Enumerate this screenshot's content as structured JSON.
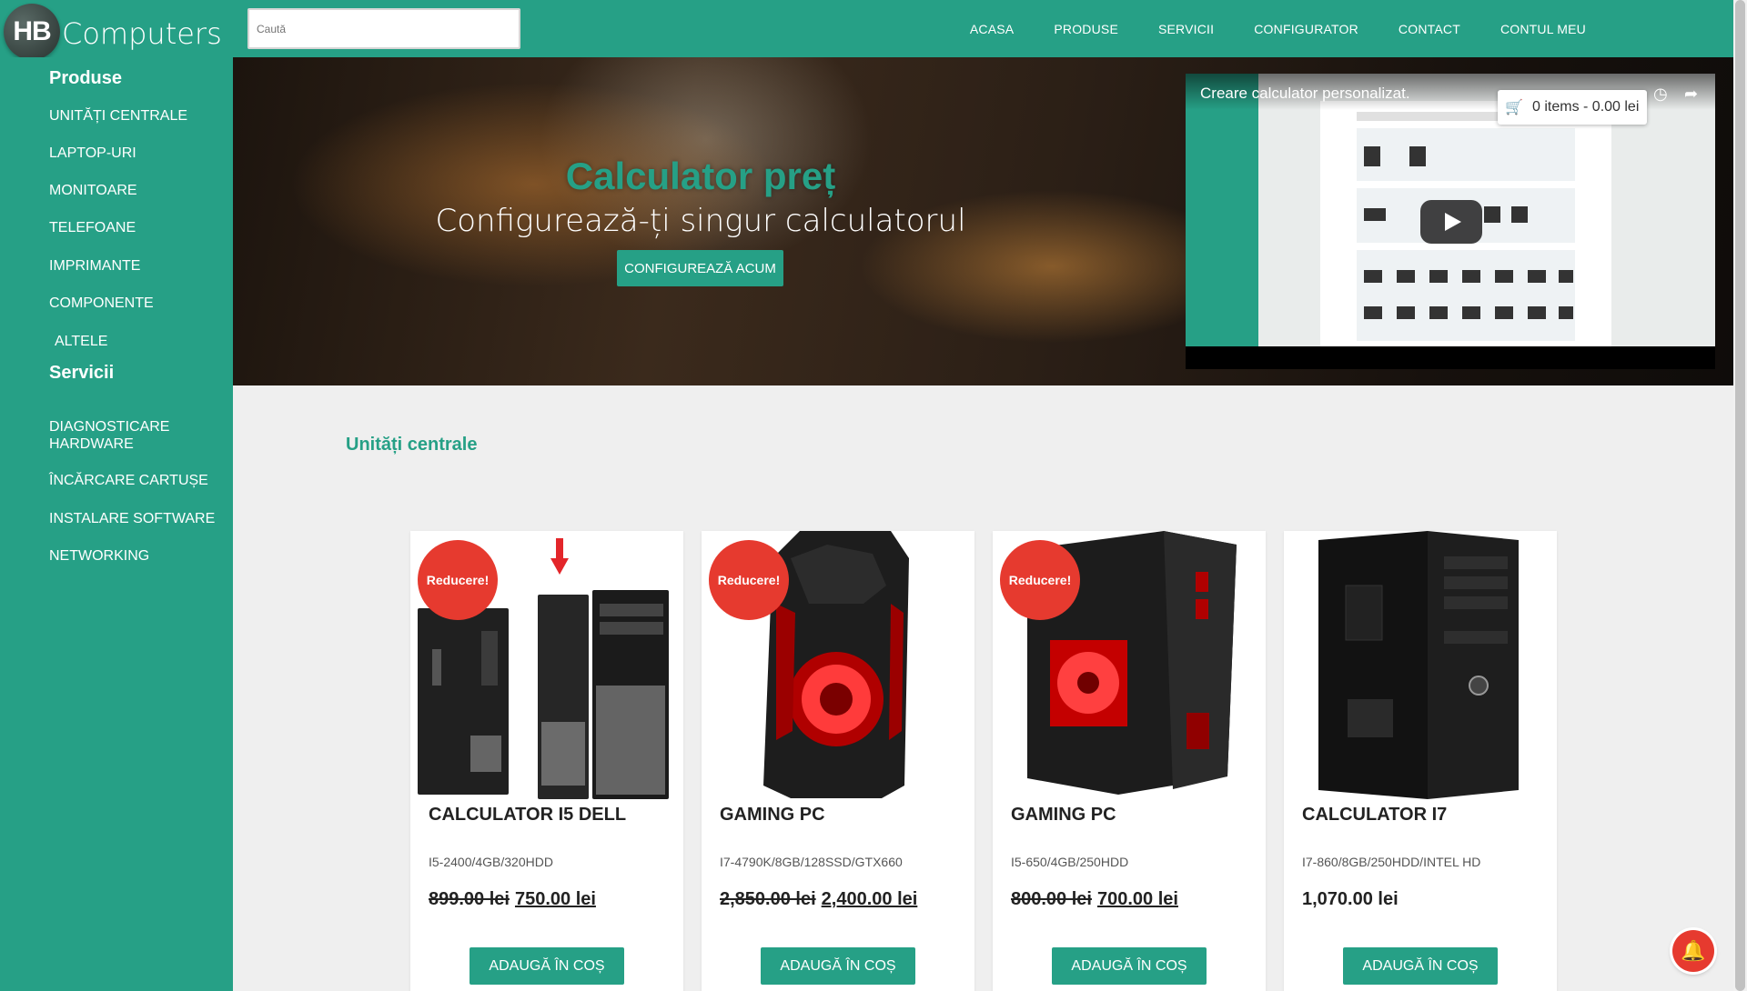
{
  "brand": {
    "logo_initials": "HB",
    "name": "Computers"
  },
  "search": {
    "placeholder": "Caută"
  },
  "nav": [
    "ACASA",
    "PRODUSE",
    "SERVICII",
    "CONFIGURATOR",
    "CONTACT",
    "CONTUL MEU"
  ],
  "sidebar": {
    "products_heading": "Produse",
    "products": [
      "UNITĂȚI CENTRALE",
      "LAPTOP-URI",
      "MONITOARE",
      "TELEFOANE",
      "IMPRIMANTE",
      "COMPONENTE",
      "ALTELE"
    ],
    "services_heading": "Servicii",
    "services": [
      "DIAGNOSTICARE HARDWARE",
      "ÎNCĂRCARE CARTUȘE",
      "INSTALARE SOFTWARE",
      "NETWORKING"
    ]
  },
  "hero": {
    "title": "Calculator preț",
    "subtitle": "Configurează-ți singur calculatorul",
    "button": "CONFIGUREAZĂ ACUM"
  },
  "video": {
    "title": "Creare calculator personalizat."
  },
  "cart": {
    "label": "0 items - 0.00 lei"
  },
  "section": {
    "title": "Unități centrale"
  },
  "products": [
    {
      "badge": "Reducere!",
      "title": "CALCULATOR I5 DELL",
      "spec": "I5-2400/4GB/320HDD",
      "old_price": "899.00 lei",
      "price": "750.00 lei",
      "button": "ADAUGĂ ÎN COȘ"
    },
    {
      "badge": "Reducere!",
      "title": "GAMING PC",
      "spec": "I7-4790K/8GB/128SSD/GTX660",
      "old_price": "2,850.00 lei",
      "price": "2,400.00 lei",
      "button": "ADAUGĂ ÎN COȘ"
    },
    {
      "badge": "Reducere!",
      "title": "GAMING PC",
      "spec": "I5-650/4GB/250HDD",
      "old_price": "800.00 lei",
      "price": "700.00 lei",
      "button": "ADAUGĂ ÎN COȘ"
    },
    {
      "badge": "",
      "title": "CALCULATOR I7",
      "spec": "I7-860/8GB/250HDD/INTEL HD",
      "old_price": "",
      "price": "1,070.00 lei",
      "button": "ADAUGĂ ÎN COȘ"
    }
  ],
  "colors": {
    "brand_green": "#26a086",
    "sale_red": "#e63a2f"
  }
}
